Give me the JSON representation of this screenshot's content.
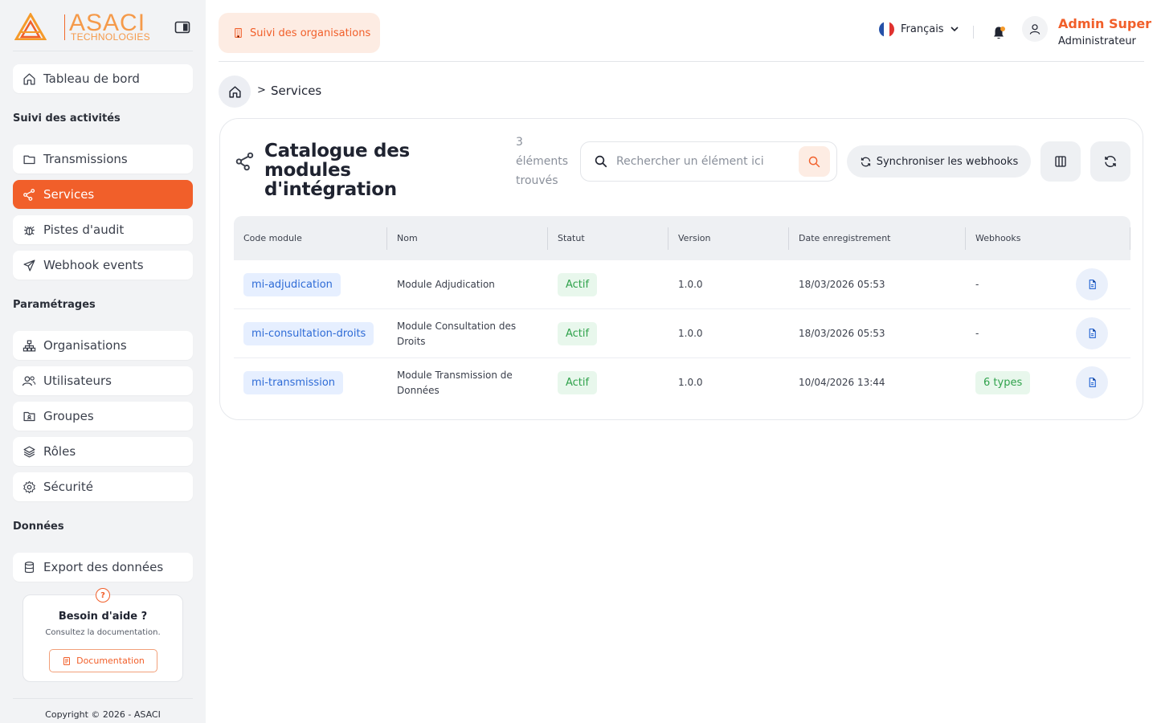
{
  "brand": {
    "logo_text": "ASACI",
    "logo_sub": "TECHNOLOGIES"
  },
  "sidebar": {
    "dashboard": "Tableau de bord",
    "sections": {
      "activities": "Suivi des activités",
      "settings": "Paramétrages",
      "data": "Données"
    },
    "activities": [
      {
        "label": "Transmissions",
        "icon": "folder-icon"
      },
      {
        "label": "Services",
        "icon": "share-icon",
        "active": true
      },
      {
        "label": "Pistes d'audit",
        "icon": "bug-icon"
      },
      {
        "label": "Webhook events",
        "icon": "send-icon"
      }
    ],
    "settings": [
      {
        "label": "Organisations",
        "icon": "hierarchy-icon"
      },
      {
        "label": "Utilisateurs",
        "icon": "users-icon"
      },
      {
        "label": "Groupes",
        "icon": "folder-user-icon"
      },
      {
        "label": "Rôles",
        "icon": "layers-icon"
      },
      {
        "label": "Sécurité",
        "icon": "gear-icon"
      }
    ],
    "data": [
      {
        "label": "Export des données",
        "icon": "database-icon"
      }
    ],
    "help": {
      "icon": "?",
      "title": "Besoin d'aide ?",
      "subtitle": "Consultez la documentation.",
      "button": "Documentation"
    },
    "copyright": "Copyright © 2026 - ASACI"
  },
  "topbar": {
    "org_button": "Suivi des organisations",
    "language": "Français",
    "user_name": "Admin Super",
    "user_role": "Administrateur"
  },
  "breadcrumb": {
    "separator": ">",
    "current": "Services"
  },
  "card": {
    "title": "Catalogue des modules d'intégration",
    "count_number": "3",
    "count_text_1": "éléments",
    "count_text_2": "trouvés",
    "search_placeholder": "Rechercher un élément ici",
    "sync_button": "Synchroniser les webhooks"
  },
  "table": {
    "columns": [
      "Code module",
      "Nom",
      "Statut",
      "Version",
      "Date enregistrement",
      "Webhooks"
    ],
    "rows": [
      {
        "code": "mi-adjudication",
        "name_l1": "Module Adjudication",
        "name_l2": "",
        "status": "Actif",
        "version": "1.0.0",
        "date": "18/03/2026 05:53",
        "webhooks": "-"
      },
      {
        "code": "mi-consultation-droits",
        "name_l1": "Module Consultation des",
        "name_l2": "Droits",
        "status": "Actif",
        "version": "1.0.0",
        "date": "18/03/2026 05:53",
        "webhooks": "-"
      },
      {
        "code": "mi-transmission",
        "name_l1": "Module Transmission de",
        "name_l2": "Données",
        "status": "Actif",
        "version": "1.0.0",
        "date": "10/04/2026 13:44",
        "webhooks": "6 types"
      }
    ]
  },
  "colors": {
    "accent": "#f15f2a",
    "accent_soft": "#fdece3",
    "sidebar_bg": "#f2f3f5",
    "code_badge": "#2e6bd6",
    "status_green": "#2fa24b"
  }
}
